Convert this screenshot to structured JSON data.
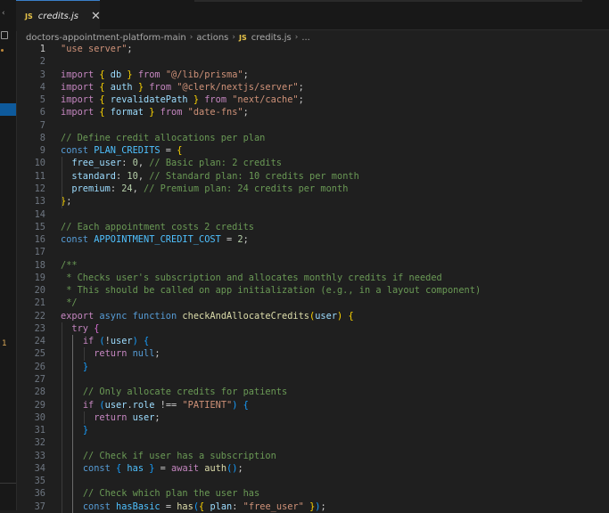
{
  "tab": {
    "lang_badge": "JS",
    "filename": "credits.js",
    "close_glyph": "✕"
  },
  "breadcrumb": {
    "root": "doctors-appointment-platform-main",
    "folder": "actions",
    "lang_badge": "JS",
    "file": "credits.js",
    "more": "..."
  },
  "activity_bar": {
    "badge_count": "1"
  },
  "active_line": 1,
  "editor_lines": [
    {
      "n": "1",
      "tokens": [
        {
          "c": "str",
          "t": "\"use server\""
        },
        {
          "c": "pl",
          "t": ";"
        }
      ]
    },
    {
      "n": "2",
      "tokens": []
    },
    {
      "n": "3",
      "tokens": [
        {
          "c": "ctl",
          "t": "import"
        },
        {
          "c": "pl",
          "t": " "
        },
        {
          "c": "br1",
          "t": "{"
        },
        {
          "c": "var",
          "t": " db "
        },
        {
          "c": "br1",
          "t": "}"
        },
        {
          "c": "ctl",
          "t": " from "
        },
        {
          "c": "str",
          "t": "\"@/lib/prisma\""
        },
        {
          "c": "pl",
          "t": ";"
        }
      ]
    },
    {
      "n": "4",
      "tokens": [
        {
          "c": "ctl",
          "t": "import"
        },
        {
          "c": "pl",
          "t": " "
        },
        {
          "c": "br1",
          "t": "{"
        },
        {
          "c": "var",
          "t": " auth "
        },
        {
          "c": "br1",
          "t": "}"
        },
        {
          "c": "ctl",
          "t": " from "
        },
        {
          "c": "str",
          "t": "\"@clerk/nextjs/server\""
        },
        {
          "c": "pl",
          "t": ";"
        }
      ]
    },
    {
      "n": "5",
      "tokens": [
        {
          "c": "ctl",
          "t": "import"
        },
        {
          "c": "pl",
          "t": " "
        },
        {
          "c": "br1",
          "t": "{"
        },
        {
          "c": "var",
          "t": " revalidatePath "
        },
        {
          "c": "br1",
          "t": "}"
        },
        {
          "c": "ctl",
          "t": " from "
        },
        {
          "c": "str",
          "t": "\"next/cache\""
        },
        {
          "c": "pl",
          "t": ";"
        }
      ]
    },
    {
      "n": "6",
      "tokens": [
        {
          "c": "ctl",
          "t": "import"
        },
        {
          "c": "pl",
          "t": " "
        },
        {
          "c": "br1",
          "t": "{"
        },
        {
          "c": "var",
          "t": " format "
        },
        {
          "c": "br1",
          "t": "}"
        },
        {
          "c": "ctl",
          "t": " from "
        },
        {
          "c": "str",
          "t": "\"date-fns\""
        },
        {
          "c": "pl",
          "t": ";"
        }
      ]
    },
    {
      "n": "7",
      "tokens": []
    },
    {
      "n": "8",
      "tokens": [
        {
          "c": "cm",
          "t": "// Define credit allocations per plan"
        }
      ]
    },
    {
      "n": "9",
      "tokens": [
        {
          "c": "kw",
          "t": "const"
        },
        {
          "c": "pl",
          "t": " "
        },
        {
          "c": "const",
          "t": "PLAN_CREDITS"
        },
        {
          "c": "pl",
          "t": " = "
        },
        {
          "c": "br1",
          "t": "{"
        }
      ]
    },
    {
      "n": "10",
      "tokens": [
        {
          "c": "pl",
          "t": "  "
        },
        {
          "c": "var",
          "t": "free_user"
        },
        {
          "c": "pl",
          "t": ": "
        },
        {
          "c": "num",
          "t": "0"
        },
        {
          "c": "pl",
          "t": ", "
        },
        {
          "c": "cm",
          "t": "// Basic plan: 2 credits"
        }
      ]
    },
    {
      "n": "11",
      "tokens": [
        {
          "c": "pl",
          "t": "  "
        },
        {
          "c": "var",
          "t": "standard"
        },
        {
          "c": "pl",
          "t": ": "
        },
        {
          "c": "num",
          "t": "10"
        },
        {
          "c": "pl",
          "t": ", "
        },
        {
          "c": "cm",
          "t": "// Standard plan: 10 credits per month"
        }
      ]
    },
    {
      "n": "12",
      "tokens": [
        {
          "c": "pl",
          "t": "  "
        },
        {
          "c": "var",
          "t": "premium"
        },
        {
          "c": "pl",
          "t": ": "
        },
        {
          "c": "num",
          "t": "24"
        },
        {
          "c": "pl",
          "t": ", "
        },
        {
          "c": "cm",
          "t": "// Premium plan: 24 credits per month"
        }
      ]
    },
    {
      "n": "13",
      "tokens": [
        {
          "c": "br1",
          "t": "}"
        },
        {
          "c": "pl",
          "t": ";"
        }
      ]
    },
    {
      "n": "14",
      "tokens": []
    },
    {
      "n": "15",
      "tokens": [
        {
          "c": "cm",
          "t": "// Each appointment costs 2 credits"
        }
      ]
    },
    {
      "n": "16",
      "tokens": [
        {
          "c": "kw",
          "t": "const"
        },
        {
          "c": "pl",
          "t": " "
        },
        {
          "c": "const",
          "t": "APPOINTMENT_CREDIT_COST"
        },
        {
          "c": "pl",
          "t": " = "
        },
        {
          "c": "num",
          "t": "2"
        },
        {
          "c": "pl",
          "t": ";"
        }
      ]
    },
    {
      "n": "17",
      "tokens": []
    },
    {
      "n": "18",
      "tokens": [
        {
          "c": "cm",
          "t": "/**"
        }
      ]
    },
    {
      "n": "19",
      "tokens": [
        {
          "c": "cm",
          "t": " * Checks user's subscription and allocates monthly credits if needed"
        }
      ]
    },
    {
      "n": "20",
      "tokens": [
        {
          "c": "cm",
          "t": " * This should be called on app initialization (e.g., in a layout component)"
        }
      ]
    },
    {
      "n": "21",
      "tokens": [
        {
          "c": "cm",
          "t": " */"
        }
      ]
    },
    {
      "n": "22",
      "tokens": [
        {
          "c": "ctl",
          "t": "export"
        },
        {
          "c": "pl",
          "t": " "
        },
        {
          "c": "kw",
          "t": "async"
        },
        {
          "c": "pl",
          "t": " "
        },
        {
          "c": "kw",
          "t": "function"
        },
        {
          "c": "pl",
          "t": " "
        },
        {
          "c": "fn",
          "t": "checkAndAllocateCredits"
        },
        {
          "c": "br1",
          "t": "("
        },
        {
          "c": "var",
          "t": "user"
        },
        {
          "c": "br1",
          "t": ")"
        },
        {
          "c": "pl",
          "t": " "
        },
        {
          "c": "br1",
          "t": "{"
        }
      ]
    },
    {
      "n": "23",
      "tokens": [
        {
          "c": "pl",
          "t": "  "
        },
        {
          "c": "ctl",
          "t": "try"
        },
        {
          "c": "pl",
          "t": " "
        },
        {
          "c": "br2",
          "t": "{"
        }
      ]
    },
    {
      "n": "24",
      "tokens": [
        {
          "c": "pl",
          "t": "    "
        },
        {
          "c": "ctl",
          "t": "if"
        },
        {
          "c": "pl",
          "t": " "
        },
        {
          "c": "br3",
          "t": "("
        },
        {
          "c": "pl",
          "t": "!"
        },
        {
          "c": "var",
          "t": "user"
        },
        {
          "c": "br3",
          "t": ")"
        },
        {
          "c": "pl",
          "t": " "
        },
        {
          "c": "br3",
          "t": "{"
        }
      ]
    },
    {
      "n": "25",
      "tokens": [
        {
          "c": "pl",
          "t": "      "
        },
        {
          "c": "ctl",
          "t": "return"
        },
        {
          "c": "pl",
          "t": " "
        },
        {
          "c": "kw",
          "t": "null"
        },
        {
          "c": "pl",
          "t": ";"
        }
      ]
    },
    {
      "n": "26",
      "tokens": [
        {
          "c": "pl",
          "t": "    "
        },
        {
          "c": "br3",
          "t": "}"
        }
      ]
    },
    {
      "n": "27",
      "tokens": []
    },
    {
      "n": "28",
      "tokens": [
        {
          "c": "pl",
          "t": "    "
        },
        {
          "c": "cm",
          "t": "// Only allocate credits for patients"
        }
      ]
    },
    {
      "n": "29",
      "tokens": [
        {
          "c": "pl",
          "t": "    "
        },
        {
          "c": "ctl",
          "t": "if"
        },
        {
          "c": "pl",
          "t": " "
        },
        {
          "c": "br3",
          "t": "("
        },
        {
          "c": "var",
          "t": "user"
        },
        {
          "c": "pl",
          "t": "."
        },
        {
          "c": "var",
          "t": "role"
        },
        {
          "c": "pl",
          "t": " !== "
        },
        {
          "c": "str",
          "t": "\"PATIENT\""
        },
        {
          "c": "br3",
          "t": ")"
        },
        {
          "c": "pl",
          "t": " "
        },
        {
          "c": "br3",
          "t": "{"
        }
      ]
    },
    {
      "n": "30",
      "tokens": [
        {
          "c": "pl",
          "t": "      "
        },
        {
          "c": "ctl",
          "t": "return"
        },
        {
          "c": "pl",
          "t": " "
        },
        {
          "c": "var",
          "t": "user"
        },
        {
          "c": "pl",
          "t": ";"
        }
      ]
    },
    {
      "n": "31",
      "tokens": [
        {
          "c": "pl",
          "t": "    "
        },
        {
          "c": "br3",
          "t": "}"
        }
      ]
    },
    {
      "n": "32",
      "tokens": []
    },
    {
      "n": "33",
      "tokens": [
        {
          "c": "pl",
          "t": "    "
        },
        {
          "c": "cm",
          "t": "// Check if user has a subscription"
        }
      ]
    },
    {
      "n": "34",
      "tokens": [
        {
          "c": "pl",
          "t": "    "
        },
        {
          "c": "kw",
          "t": "const"
        },
        {
          "c": "pl",
          "t": " "
        },
        {
          "c": "br3",
          "t": "{"
        },
        {
          "c": "pl",
          "t": " "
        },
        {
          "c": "const",
          "t": "has"
        },
        {
          "c": "pl",
          "t": " "
        },
        {
          "c": "br3",
          "t": "}"
        },
        {
          "c": "pl",
          "t": " = "
        },
        {
          "c": "ctl",
          "t": "await"
        },
        {
          "c": "pl",
          "t": " "
        },
        {
          "c": "fn",
          "t": "auth"
        },
        {
          "c": "br3",
          "t": "()"
        },
        {
          "c": "pl",
          "t": ";"
        }
      ]
    },
    {
      "n": "35",
      "tokens": []
    },
    {
      "n": "36",
      "tokens": [
        {
          "c": "pl",
          "t": "    "
        },
        {
          "c": "cm",
          "t": "// Check which plan the user has"
        }
      ]
    },
    {
      "n": "37",
      "tokens": [
        {
          "c": "pl",
          "t": "    "
        },
        {
          "c": "kw",
          "t": "const"
        },
        {
          "c": "pl",
          "t": " "
        },
        {
          "c": "const",
          "t": "hasBasic"
        },
        {
          "c": "pl",
          "t": " = "
        },
        {
          "c": "fn",
          "t": "has"
        },
        {
          "c": "br3",
          "t": "("
        },
        {
          "c": "br1",
          "t": "{"
        },
        {
          "c": "pl",
          "t": " "
        },
        {
          "c": "var",
          "t": "plan"
        },
        {
          "c": "pl",
          "t": ": "
        },
        {
          "c": "str",
          "t": "\"free_user\""
        },
        {
          "c": "pl",
          "t": " "
        },
        {
          "c": "br1",
          "t": "}"
        },
        {
          "c": "br3",
          "t": ")"
        },
        {
          "c": "pl",
          "t": ";"
        }
      ]
    }
  ]
}
